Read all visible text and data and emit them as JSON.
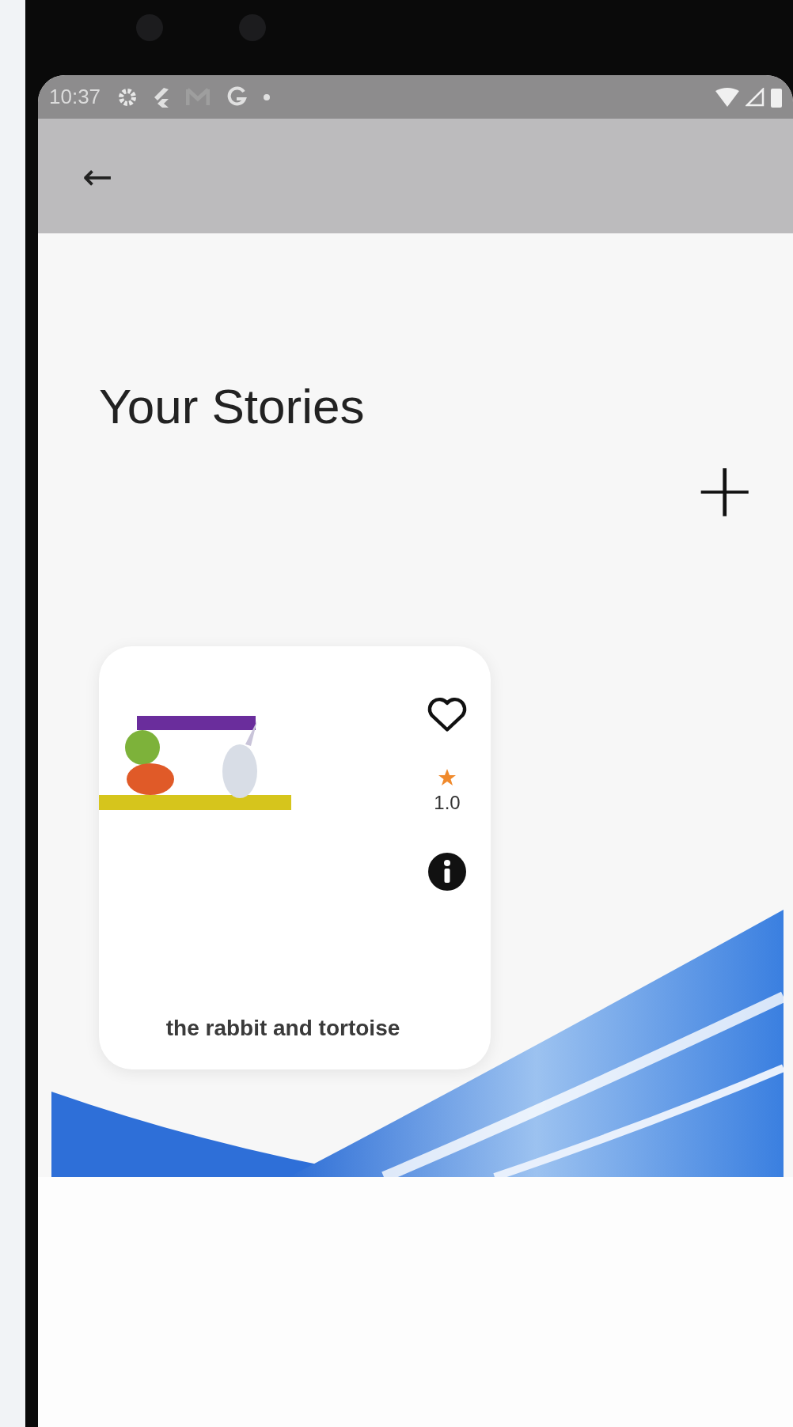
{
  "status_bar": {
    "time": "10:37"
  },
  "app_bar": {
    "back": "←"
  },
  "page": {
    "title": "Your Stories",
    "add": "+"
  },
  "stories": [
    {
      "title": "the rabbit and tortoise",
      "favorite": false,
      "rating": "1.0"
    }
  ]
}
